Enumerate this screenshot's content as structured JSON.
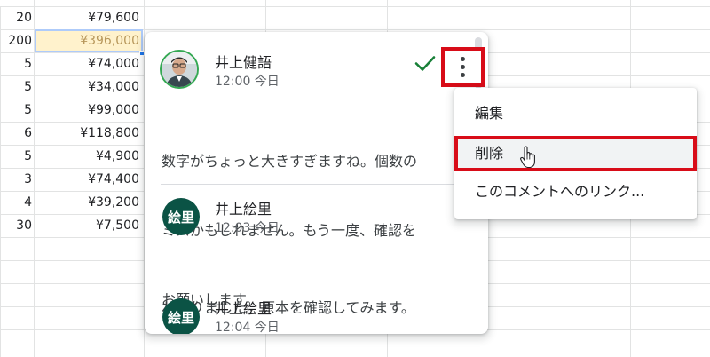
{
  "sheet": {
    "rows": [
      {
        "qty": "20",
        "price": "¥79,600",
        "selected": false
      },
      {
        "qty": "200",
        "price": "¥396,000",
        "selected": true
      },
      {
        "qty": "5",
        "price": "¥74,000",
        "selected": false
      },
      {
        "qty": "5",
        "price": "¥34,000",
        "selected": false
      },
      {
        "qty": "5",
        "price": "¥99,000",
        "selected": false
      },
      {
        "qty": "6",
        "price": "¥118,800",
        "selected": false
      },
      {
        "qty": "5",
        "price": "¥4,900",
        "selected": false
      },
      {
        "qty": "3",
        "price": "¥74,400",
        "selected": false
      },
      {
        "qty": "4",
        "price": "¥39,200",
        "selected": false
      },
      {
        "qty": "30",
        "price": "¥7,500",
        "selected": false
      }
    ]
  },
  "comments": [
    {
      "author": "井上健語",
      "time": "12:00 今日",
      "avatar_type": "photo",
      "text_lines": [
        "数字がちょっと大きすぎますね。個数の",
        "ミスかもしれません。もう一度、確認を",
        "お願いします。"
      ]
    },
    {
      "author": "井上絵里",
      "time": "12:03 今日",
      "avatar_type": "initials",
      "avatar_initials": "絵里",
      "text_lines": [
        "わかりました。原本を確認してみます。"
      ]
    },
    {
      "author": "井上絵里",
      "time": "12:04 今日",
      "avatar_type": "initials",
      "avatar_initials": "絵里",
      "text_lines": []
    }
  ],
  "menu": {
    "items": [
      {
        "label": "編集",
        "highlighted": false
      },
      {
        "label": "削除",
        "highlighted": true
      },
      {
        "label": "このコメントへのリンク...",
        "highlighted": false
      }
    ]
  },
  "icons": {
    "resolve": "check-icon",
    "more": "more-vertical-icon",
    "cursor": "hand-pointer-icon"
  },
  "colors": {
    "highlight_border": "#d80c18",
    "avatar_bg": "#0b5345",
    "selected_cell_bg": "#fff2cc",
    "check_green": "#188038"
  }
}
